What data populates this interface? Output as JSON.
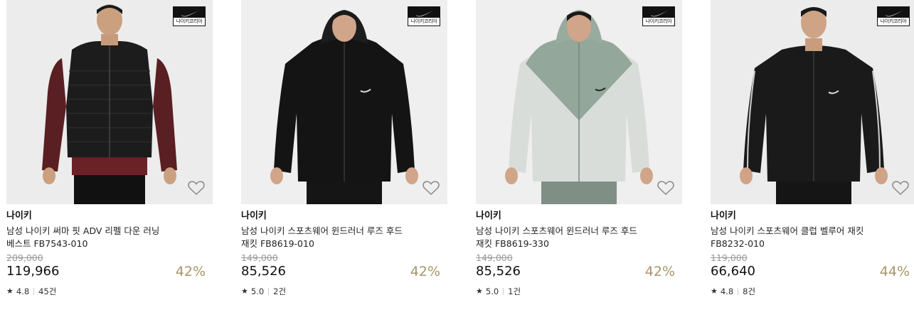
{
  "badge_text": "나이키코리아",
  "products": [
    {
      "brand": "나이키",
      "name": "남성 나이키 써마 핏 ADV 리펠 다운 러닝 베스트 FB7543-010",
      "original_price": "209,000",
      "price": "119,966",
      "discount": "42%",
      "rating": "4.8",
      "reviews": "45건"
    },
    {
      "brand": "나이키",
      "name": "남성 나이키 스포츠웨어 윈드러너 루즈 후드 재킷 FB8619-010",
      "original_price": "149,000",
      "price": "85,526",
      "discount": "42%",
      "rating": "5.0",
      "reviews": "2건"
    },
    {
      "brand": "나이키",
      "name": "남성 나이키 스포츠웨어 윈드러너 루즈 후드 재킷 FB8619-330",
      "original_price": "149,000",
      "price": "85,526",
      "discount": "42%",
      "rating": "5.0",
      "reviews": "1건"
    },
    {
      "brand": "나이키",
      "name": "남성 나이키 스포츠웨어 클럽 벨루어 재킷 FB8232-010",
      "original_price": "119,000",
      "price": "66,640",
      "discount": "44%",
      "rating": "4.8",
      "reviews": "8건"
    }
  ],
  "colors": {
    "discount": "#a8956a",
    "star": "#111111"
  },
  "icons": {
    "wishlist": "heart-outline-icon",
    "rating": "star-icon",
    "brand_logo": "nike-swoosh-icon"
  }
}
